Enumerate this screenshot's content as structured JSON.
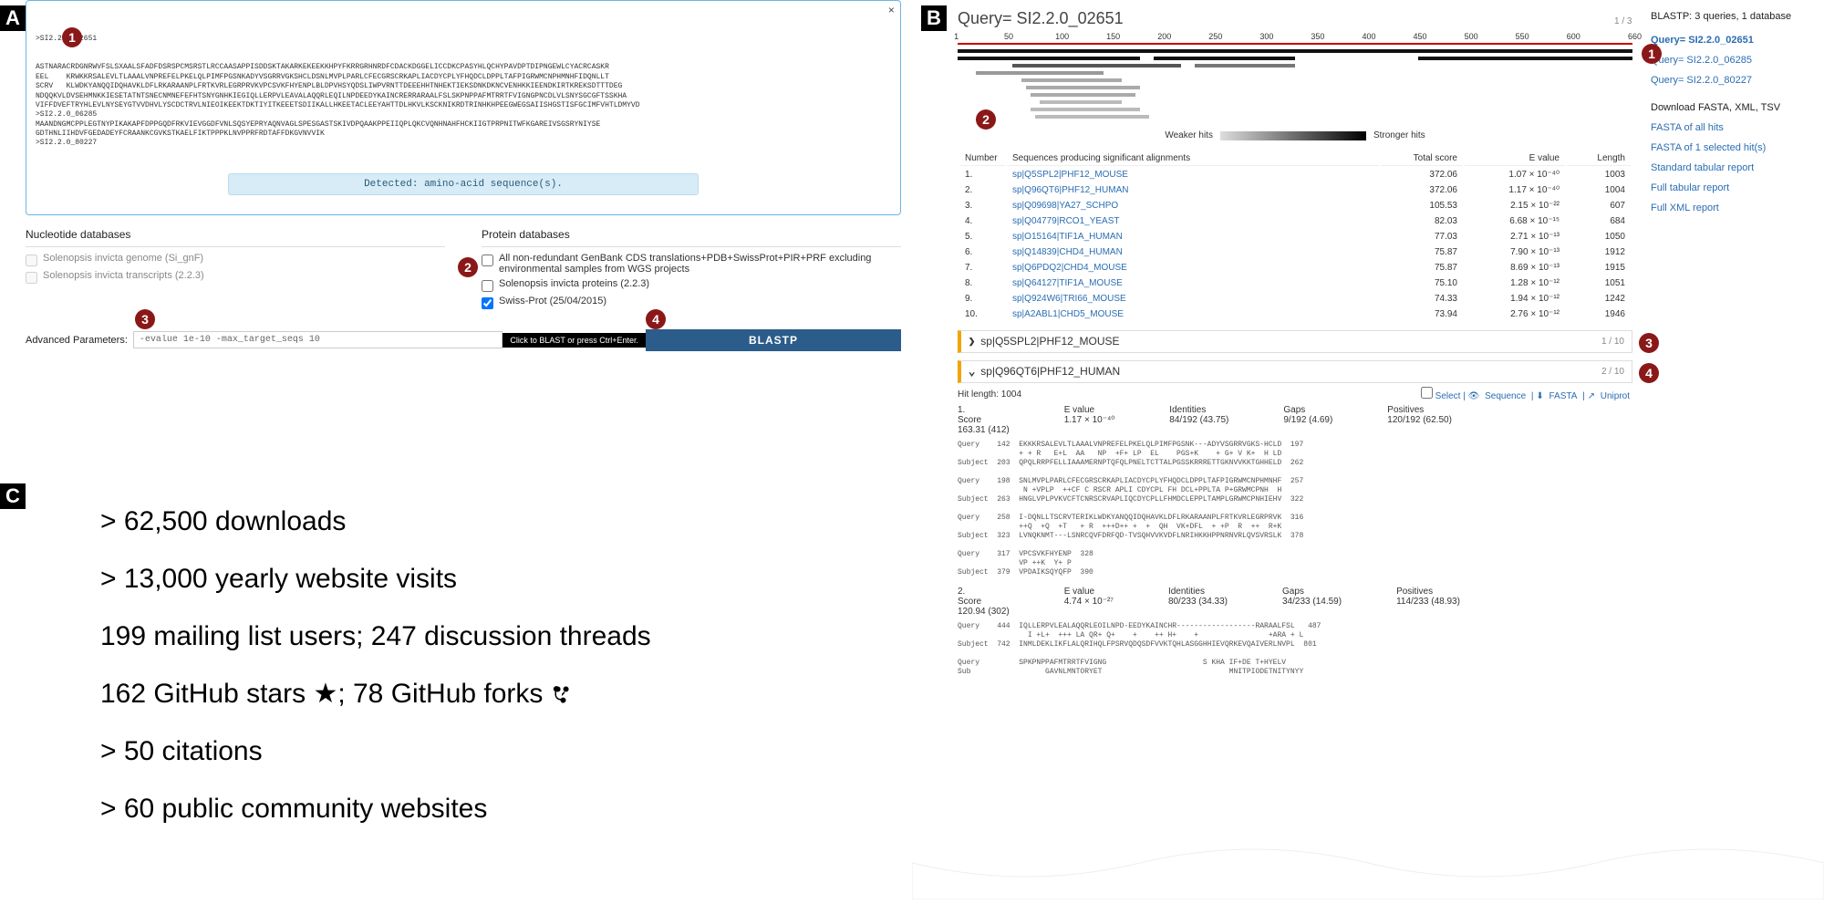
{
  "panels": {
    "a": "A",
    "b": "B",
    "c": "C"
  },
  "badges": {
    "a1": "1",
    "a2": "2",
    "a3": "3",
    "a4": "4",
    "b1": "1",
    "b2": "2",
    "b3": "3",
    "b4": "4"
  },
  "panelA": {
    "seq_header1": ">SI2.2.0_02651",
    "seq_lines": "ASTNARACRDGNRWVFSLSXAALSFADFDSRSPCMSRSTLRCCAASAPPISDDSKTAKARKEKEEKKHPYFKRRGRHNRDFCDACKDGGELICCDKCPASYHLQCHYPAVDPTDIPNGEWLCYACRCASKR\nEEL    KRWKKRSALEVLTLAAALVNPREFELPKELQLPIMFPGSNKADYVSGRRVGKSHCLDSNLMVPLPARLCFECGRSCRKAPLIACDYCPLYFHQDCLDPPLTAFPIGRWMCNPHMNHFIDQNLLT\nSCRV   KLWDKYANQQIDQHAVKLDFLRKARAANPLFRTKVRLEGRPRVKVPCSVKFHYENPLBLDPVHSYQDSLIWPVRNTTDEEEHHTNHEKTIEKSDNKDKNCVENHKKIEENDKIRTKREKSDTTTDEG\nNDQQKVLDVSEHMNKKIESETATNTSNECNMNEFEFHTSNYGNHKIEGIQLLERPVLEAVALAQQRLEQILNPDEEDYKAINCRERRARAALFSLSKPNPPAFMTRRTFVIGNGPNCDLVLSNYSGCGFTSSKHA\nVIFFDVEFTRYHLEVLNYSEYGTVVDHVLYSCDCTRVLNIEOIKEEKTDKTIYITKEEETSDIIKALLHKEETACLEEYAHTTDLHKVLKSCKNIKRDTRINHKHPEEGWEGSAIISHGSTISFGCIMFVHTLDMYVD\n>SI2.2.0_06285\nMAANDNGMCPPLEGTNYPIKAKAPFDPPGQDFRKVIEVGGDFVNLSQSYEPRYAQNVAGLSPESGASTSKIVDPQAAKPPEIIQPLQKCVQNHNAHFHCKIIGTPRPNITWFKGAREIVSGSRYNIYSE\nGDTHNLIIHDVFGEDADEYFCRAANKCGVKSTKAELFIKTPPPKLNVPPRFRDTAFFDKGVNVVIK\n>SI2.2.0_80227",
    "close": "×",
    "detected": "Detected: amino-acid sequence(s).",
    "nuc_header": "Nucleotide databases",
    "nuc_items": [
      "Solenopsis invicta genome (Si_gnF)",
      "Solenopsis invicta transcripts (2.2.3)"
    ],
    "prot_header": "Protein databases",
    "prot_items": [
      "All non-redundant GenBank CDS translations+PDB+SwissProt+PIR+PRF excluding environmental samples from WGS projects",
      "Solenopsis invicta proteins (2.2.3)",
      "Swiss-Prot (25/04/2015)"
    ],
    "adv_label": "Advanced Parameters:",
    "adv_value": "-evalue 1e-10 -max_target_seqs 10",
    "hint": "Click to BLAST or press Ctrl+Enter.",
    "blast_btn": "BLASTP"
  },
  "panelC": {
    "l1": "> 62,500 downloads",
    "l2": "> 13,000 yearly website visits",
    "l3": "199 mailing list users; 247 discussion threads",
    "l4": "162 GitHub stars ★; 78 GitHub forks ",
    "l5": "> 50 citations",
    "l6": "> 60 public community websites"
  },
  "panelB": {
    "query_title": "Query= SI2.2.0_02651",
    "page_ctr_top": "1 / 3",
    "rail_header": "BLASTP: 3 queries, 1 database",
    "queries": [
      "Query= SI2.2.0_02651",
      "Query= SI2.2.0_06285",
      "Query= SI2.2.0_80227"
    ],
    "dl_header": "Download FASTA, XML, TSV",
    "dl_links": [
      "FASTA of all hits",
      "FASTA of 1 selected hit(s)",
      "Standard tabular report",
      "Full tabular report",
      "Full XML report"
    ],
    "ruler_ticks": [
      1,
      50,
      100,
      150,
      200,
      250,
      300,
      350,
      400,
      450,
      500,
      550,
      600,
      660
    ],
    "legend_weak": "Weaker hits",
    "legend_strong": "Stronger hits",
    "table_headers": [
      "Number",
      "Sequences producing significant alignments",
      "Total score",
      "E value",
      "Length"
    ],
    "hits": [
      {
        "n": "1.",
        "name": "sp|Q5SPL2|PHF12_MOUSE",
        "score": "372.06",
        "ev": "1.07 × 10⁻⁴⁰",
        "len": "1003"
      },
      {
        "n": "2.",
        "name": "sp|Q96QT6|PHF12_HUMAN",
        "score": "372.06",
        "ev": "1.17 × 10⁻⁴⁰",
        "len": "1004"
      },
      {
        "n": "3.",
        "name": "sp|Q09698|YA27_SCHPO",
        "score": "105.53",
        "ev": "2.15 × 10⁻²²",
        "len": "607"
      },
      {
        "n": "4.",
        "name": "sp|Q04779|RCO1_YEAST",
        "score": "82.03",
        "ev": "6.68 × 10⁻¹⁵",
        "len": "684"
      },
      {
        "n": "5.",
        "name": "sp|O15164|TIF1A_HUMAN",
        "score": "77.03",
        "ev": "2.71 × 10⁻¹³",
        "len": "1050"
      },
      {
        "n": "6.",
        "name": "sp|Q14839|CHD4_HUMAN",
        "score": "75.87",
        "ev": "7.90 × 10⁻¹³",
        "len": "1912"
      },
      {
        "n": "7.",
        "name": "sp|Q6PDQ2|CHD4_MOUSE",
        "score": "75.87",
        "ev": "8.69 × 10⁻¹³",
        "len": "1915"
      },
      {
        "n": "8.",
        "name": "sp|Q64127|TIF1A_MOUSE",
        "score": "75.10",
        "ev": "1.28 × 10⁻¹²",
        "len": "1051"
      },
      {
        "n": "9.",
        "name": "sp|Q924W6|TRI66_MOUSE",
        "score": "74.33",
        "ev": "1.94 × 10⁻¹²",
        "len": "1242"
      },
      {
        "n": "10.",
        "name": "sp|A2ABL1|CHD5_MOUSE",
        "score": "73.94",
        "ev": "2.76 × 10⁻¹²",
        "len": "1946"
      }
    ],
    "hit_collapsed": "sp|Q5SPL2|PHF12_MOUSE",
    "hit_collapsed_ctr": "1 / 10",
    "hit_open": "sp|Q96QT6|PHF12_HUMAN",
    "hit_open_ctr": "2 / 10",
    "hit_len": "Hit length: 1004",
    "select": "Select",
    "tool_seq": "Sequence",
    "tool_fasta": "FASTA",
    "tool_uni": "Uniprot",
    "stats_labels": [
      "Score",
      "E value",
      "Identities",
      "Gaps",
      "Positives"
    ],
    "seg1": {
      "idx": "1.",
      "score": "163.31 (412)",
      "ev": "1.17 × 10⁻⁴⁰",
      "ident": "84/192 (43.75)",
      "gaps": "9/192 (4.69)",
      "pos": "120/192 (62.50)",
      "align": "Query    142  EKKKRSALEVLTLAAALVNPREFELPKELQLPIMFPGSNK---ADYVSGRRVGKS-HCLD  197\n              + + R   E+L  AA   NP  +F+ LP  EL    PGS+K    + G+ V K+  H LD\nSubject  203  QPQLRRPFELLIAAAMERNPTQFQLPNELTCTTALPGSSKRRRETTGKNVVKKTGHHELD  262\n\nQuery    198  SNLMVPLPARLCFECGRSCRKAPLIACDYCPLYFHQDCLDPPLTAFPIGRWMCNPHMNHF  257\n               N +VPLP  ++CF C RSCR APLI CDYCPL FH DCL+PPLTA P+GRWMCPNH  H\nSubject  263  HNGLVPLPVKVCFTCNRSCRVAPLIQCDYCPLLFHMDCLEPPLTAMPLGRWMCPNHIEHV  322\n\nQuery    258  I-DQNLLTSCRVTERIKLWDKYANQQIDQHAVKLDFLRKARAANPLFRTKVRLEGRPRVK  316\n              ++Q  +Q  +T   + R  +++D++ +  +  QH  VK+DFL  + +P  R  ++  R+K\nSubject  323  LVNQKNMT---LSNRCQVFDRFQD-TVSQHVVKVDFLNRIHKKHPPNRNVRLQVSVRSLK  378\n\nQuery    317  VPCSVKFHYENP  328\n              VP ++K  Y+ P\nSubject  379  VPDAIKSQYQFP  390"
    },
    "seg2": {
      "idx": "2.",
      "score": "120.94 (302)",
      "ev": "4.74 × 10⁻²⁷",
      "ident": "80/233 (34.33)",
      "gaps": "34/233 (14.59)",
      "pos": "114/233 (48.93)",
      "align": "Query    444  IQLLERPVLEALAQQRLEOILNPD-EEDYKAINCHR------------------RARAALFSL   487\n                I +L+  +++ LA QR+ Q+    +    ++ H+    +                +ARA + L\nSubject  742  INMLDEKLIKFLALQRIHQLFPSRVQDQSDFVVKTQHLASGGHHIEVQRKEVQAIVERLNVPL  801\n\nQuery         SPKPNPPAFMTRRTFVIGNG                      S KHA IF+DE T+HYELV\nSub                 GAVNLMNTORYET                             MNITPIODETNITYNYY"
    }
  }
}
